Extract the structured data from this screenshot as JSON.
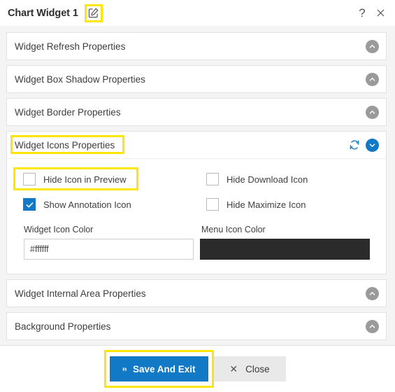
{
  "titlebar": {
    "title": "Chart Widget 1",
    "edit_icon": "edit-pencil-square-icon",
    "help_label": "?",
    "close_label": "✕"
  },
  "accordions": [
    {
      "label": "Widget Refresh Properties",
      "expanded": false,
      "toggle_icon": "chevron-up-icon"
    },
    {
      "label": "Widget Box Shadow Properties",
      "expanded": false,
      "toggle_icon": "chevron-up-icon"
    },
    {
      "label": "Widget Border Properties",
      "expanded": false,
      "toggle_icon": "chevron-up-icon"
    },
    {
      "label": "Widget Icons Properties",
      "expanded": true,
      "toggle_icon": "chevron-down-icon",
      "refresh_icon": "refresh-icon"
    },
    {
      "label": "Widget Internal Area Properties",
      "expanded": false,
      "toggle_icon": "chevron-up-icon"
    },
    {
      "label": "Background Properties",
      "expanded": false,
      "toggle_icon": "chevron-up-icon"
    }
  ],
  "widget_icons_properties": {
    "checkboxes": [
      {
        "label": "Hide Icon in Preview",
        "checked": false,
        "highlighted": true
      },
      {
        "label": "Show Annotation Icon",
        "checked": true,
        "highlighted": false
      },
      {
        "label": "Hide Download Icon",
        "checked": false,
        "highlighted": false
      },
      {
        "label": "Hide Maximize Icon",
        "checked": false,
        "highlighted": false
      }
    ],
    "widget_icon_color": {
      "label": "Widget Icon Color",
      "value": "#ffffff",
      "placeholder": "#ffffff"
    },
    "menu_icon_color": {
      "label": "Menu Icon Color",
      "value": "#2b2b2b"
    }
  },
  "footer": {
    "save_label": "Save And Exit",
    "save_icon": "save-floppy-icon",
    "close_label": "Close",
    "close_icon": "close-x-icon"
  },
  "colors": {
    "accent_blue": "#1279c6",
    "highlight_yellow": "#ffe600",
    "chevron_gray": "#9a9a9a",
    "panel_bg": "#f4f4f4",
    "menu_icon_swatch": "#2b2b2b"
  }
}
